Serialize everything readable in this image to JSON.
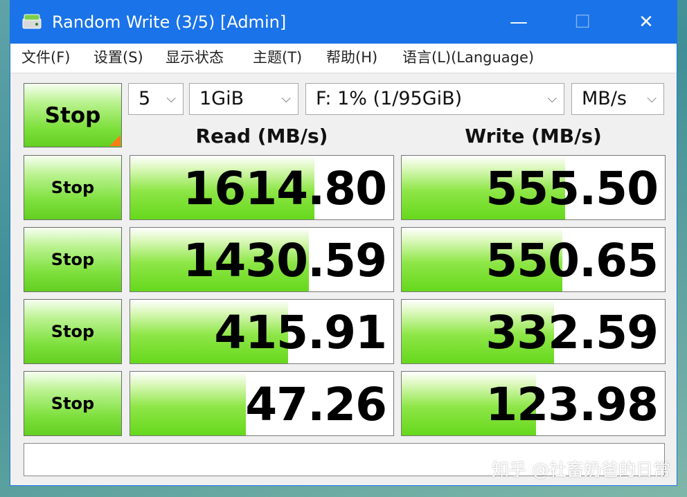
{
  "window": {
    "title": "Random Write (3/5) [Admin]",
    "controls": {
      "minimize": "—",
      "maximize": "☐",
      "close": "✕"
    }
  },
  "menu": {
    "items": [
      "文件(F)",
      "设置(S)",
      "显示状态",
      "主题(T)",
      "帮助(H)",
      "语言(L)(Language)"
    ]
  },
  "settings": {
    "count": "5",
    "size": "1GiB",
    "drive": "F: 1% (1/95GiB)",
    "unit": "MB/s"
  },
  "buttons": {
    "main": "Stop",
    "rows": [
      "Stop",
      "Stop",
      "Stop",
      "Stop"
    ]
  },
  "headers": {
    "read": "Read (MB/s)",
    "write": "Write (MB/s)"
  },
  "results": {
    "read": [
      "1614.80",
      "1430.59",
      "415.91",
      "47.26"
    ],
    "write": [
      "555.50",
      "550.65",
      "332.59",
      "123.98"
    ],
    "read_fill": [
      0.7,
      0.68,
      0.6,
      0.44
    ],
    "write_fill": [
      0.62,
      0.61,
      0.58,
      0.51
    ]
  },
  "colors": {
    "titlebar": "#1a73e8",
    "accent_orange": "#ff7b15",
    "green": "#66d81c"
  },
  "watermark": "知乎 @社畜奶爸的日常"
}
